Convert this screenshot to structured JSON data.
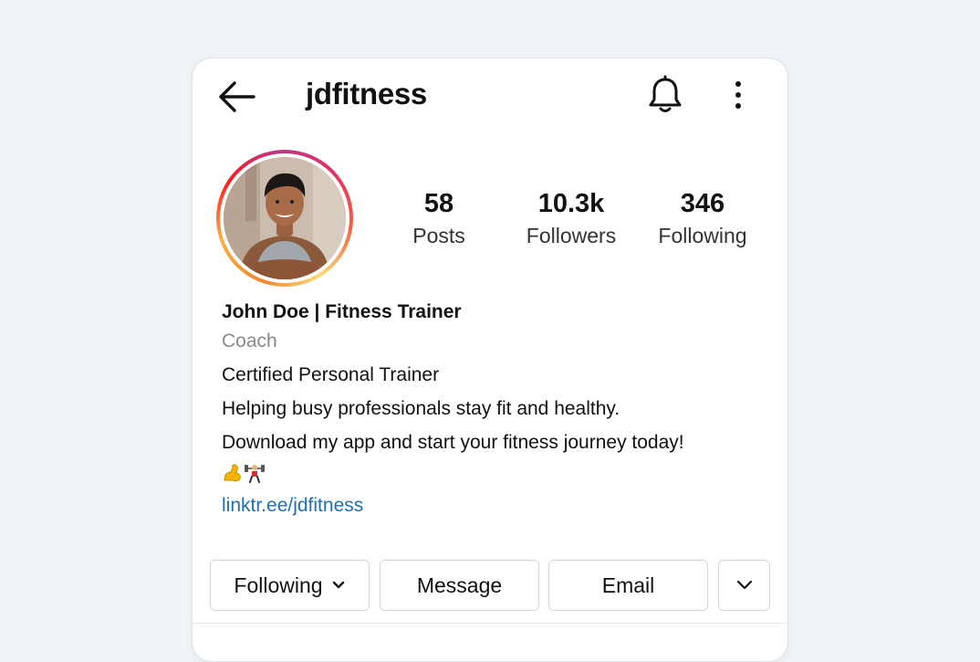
{
  "header": {
    "username": "jdfitness"
  },
  "stats": [
    {
      "count": "58",
      "label": "Posts"
    },
    {
      "count": "10.3k",
      "label": "Followers"
    },
    {
      "count": "346",
      "label": "Following"
    }
  ],
  "bio": {
    "name": "John Doe | Fitness Trainer",
    "category": "Coach",
    "lines": [
      "Certified Personal Trainer",
      "Helping busy professionals stay fit and healthy.",
      "Download my app and start your fitness journey today!"
    ],
    "emoji": "💪🏋",
    "link": "linktr.ee/jdfitness"
  },
  "actions": {
    "following_label": "Following",
    "message_label": "Message",
    "email_label": "Email"
  },
  "icons": {
    "back": "arrow-left-icon",
    "notifications": "bell-icon",
    "more": "more-vertical-icon",
    "following_dropdown": "chevron-down-icon",
    "suggested": "chevron-down-icon"
  },
  "colors": {
    "link": "#1f6fb2",
    "category": "#8a8a8a",
    "story_ring": [
      "#f58529",
      "#fcb045",
      "#fd1d1d",
      "#c13584",
      "#e1306c"
    ]
  }
}
